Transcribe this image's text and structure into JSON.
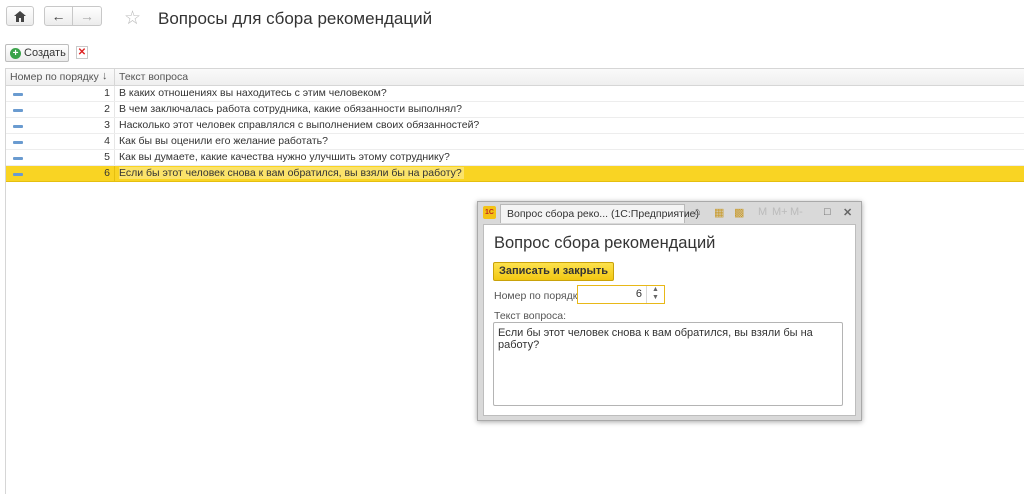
{
  "nav": {
    "title": "Вопросы для сбора рекомендаций",
    "home_icon": "home-icon",
    "back_icon": "arrow-left-icon",
    "forward_icon": "arrow-right-icon",
    "favorite_icon": "star-icon"
  },
  "toolbar": {
    "create_label": "Создать",
    "delete_icon": "delete-icon"
  },
  "table": {
    "columns": {
      "number": "Номер по порядку",
      "text": "Текст вопроса"
    },
    "rows": [
      {
        "number": "1",
        "text": "В каких отношениях вы находитесь с этим человеком?"
      },
      {
        "number": "2",
        "text": "В чем заключалась работа сотрудника, какие обязанности выполнял?"
      },
      {
        "number": "3",
        "text": "Насколько этот человек справлялся с выполнением своих обязанностей?"
      },
      {
        "number": "4",
        "text": "Как бы вы оценили его желание работать?"
      },
      {
        "number": "5",
        "text": "Как вы думаете, какие качества нужно улучшить этому сотруднику?"
      },
      {
        "number": "6",
        "text": "Если бы этот человек снова к вам обратился, вы взяли бы на работу?"
      }
    ],
    "selected_index": 5
  },
  "modal": {
    "tab_title": "Вопрос сбора реко... (1С:Предприятие)",
    "heading": "Вопрос сбора рекомендаций",
    "save_label": "Записать и закрыть",
    "number_label": "Номер по порядку:",
    "number_value": "6",
    "text_label": "Текст вопроса:",
    "text_value": "Если бы этот человек снова к вам обратился, вы взяли бы на работу?",
    "titlebar_buttons": {
      "m": "M",
      "mplus": "M+",
      "mminus": "M-"
    }
  },
  "colors": {
    "selection": "#f9d423",
    "accent_button": "#f2c812"
  }
}
